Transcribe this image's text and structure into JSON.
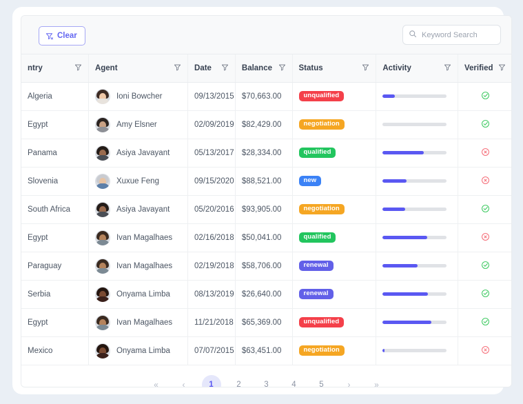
{
  "toolbar": {
    "clear_label": "Clear",
    "clear_icon": "filter-slash-icon",
    "search_placeholder": "Keyword Search",
    "search_value": "",
    "search_icon": "search-icon"
  },
  "table": {
    "columns": [
      {
        "key": "country",
        "label": "ntry",
        "filter_icon": "filter-icon"
      },
      {
        "key": "agent",
        "label": "Agent",
        "filter_icon": "filter-icon"
      },
      {
        "key": "date",
        "label": "Date",
        "filter_icon": "filter-icon"
      },
      {
        "key": "balance",
        "label": "Balance",
        "filter_icon": "filter-icon"
      },
      {
        "key": "status",
        "label": "Status",
        "filter_icon": "filter-icon"
      },
      {
        "key": "activity",
        "label": "Activity",
        "filter_icon": "filter-icon"
      },
      {
        "key": "verified",
        "label": "Verified",
        "filter_icon": "filter-icon"
      }
    ],
    "rows": [
      {
        "country": "Algeria",
        "agent": "Ioni Bowcher",
        "date": "09/13/2015",
        "balance": "$70,663.00",
        "status": "unqualified",
        "activity": 19,
        "verified": true
      },
      {
        "country": "Egypt",
        "agent": "Amy Elsner",
        "date": "02/09/2019",
        "balance": "$82,429.00",
        "status": "negotiation",
        "activity": 0,
        "verified": true
      },
      {
        "country": "Panama",
        "agent": "Asiya Javayant",
        "date": "05/13/2017",
        "balance": "$28,334.00",
        "status": "qualified",
        "activity": 64,
        "verified": false
      },
      {
        "country": "Slovenia",
        "agent": "Xuxue Feng",
        "date": "09/15/2020",
        "balance": "$88,521.00",
        "status": "new",
        "activity": 37,
        "verified": false
      },
      {
        "country": "South Africa",
        "agent": "Asiya Javayant",
        "date": "05/20/2016",
        "balance": "$93,905.00",
        "status": "negotiation",
        "activity": 35,
        "verified": true
      },
      {
        "country": "Egypt",
        "agent": "Ivan Magalhaes",
        "date": "02/16/2018",
        "balance": "$50,041.00",
        "status": "qualified",
        "activity": 69,
        "verified": false
      },
      {
        "country": "Paraguay",
        "agent": "Ivan Magalhaes",
        "date": "02/19/2018",
        "balance": "$58,706.00",
        "status": "renewal",
        "activity": 55,
        "verified": true
      },
      {
        "country": "Serbia",
        "agent": "Onyama Limba",
        "date": "08/13/2019",
        "balance": "$26,640.00",
        "status": "renewal",
        "activity": 71,
        "verified": true
      },
      {
        "country": "Egypt",
        "agent": "Ivan Magalhaes",
        "date": "11/21/2018",
        "balance": "$65,369.00",
        "status": "unqualified",
        "activity": 76,
        "verified": true
      },
      {
        "country": "Mexico",
        "agent": "Onyama Limba",
        "date": "07/07/2015",
        "balance": "$63,451.00",
        "status": "negotiation",
        "activity": 3,
        "verified": false
      }
    ]
  },
  "status_colors": {
    "unqualified": "#f4404a",
    "negotiation": "#f5a623",
    "qualified": "#22c55e",
    "new": "#3b82f6",
    "renewal": "#6260e8"
  },
  "verified_colors": {
    "true": "#34c759",
    "false": "#f4606c"
  },
  "activity_colors": {
    "fill": "#5a58f2",
    "track": "#e0e2e6"
  },
  "avatar_colors": [
    {
      "hair": "#3d2b24",
      "face": "#f0c8a8",
      "body": "#e8e3dd"
    },
    {
      "hair": "#2b2320",
      "face": "#c9a184",
      "body": "#8e9096"
    },
    {
      "hair": "#241c18",
      "face": "#9a6b4e",
      "body": "#4a4e55"
    },
    {
      "hair": "#c9cbd0",
      "face": "#e8c3a3",
      "body": "#5d7fa8"
    },
    {
      "hair": "#241c18",
      "face": "#9a6b4e",
      "body": "#4a4e55"
    },
    {
      "hair": "#3a2a20",
      "face": "#b5835c",
      "body": "#7c8a94"
    },
    {
      "hair": "#3a2a20",
      "face": "#b5835c",
      "body": "#7c8a94"
    },
    {
      "hair": "#24150f",
      "face": "#7a4a32",
      "body": "#3a201a"
    },
    {
      "hair": "#3a2a20",
      "face": "#b5835c",
      "body": "#7c8a94"
    },
    {
      "hair": "#24150f",
      "face": "#7a4a32",
      "body": "#3a201a"
    }
  ],
  "pagination": {
    "first_label": "«",
    "prev_label": "‹",
    "pages": [
      "1",
      "2",
      "3",
      "4",
      "5"
    ],
    "active_page": "1",
    "next_label": "›",
    "last_label": "»"
  }
}
